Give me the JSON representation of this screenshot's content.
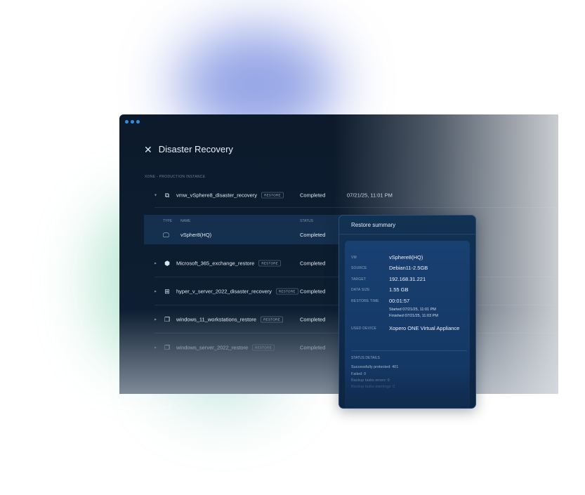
{
  "app": {
    "title": "Disaster Recovery",
    "instance_label": "XONE - PRODUCTION INSTANCE",
    "title_icon": "x-logo-icon"
  },
  "jobs": [
    {
      "name": "vmw_vSphere8_disaster_recovery",
      "badge": "RESTORE",
      "status": "Completed",
      "date": "07/21/25, 11:01 PM",
      "icon": "vm-copy-icon",
      "expanded": true
    },
    {
      "name": "Microsoft_365_exchange_restore",
      "badge": "RESTORE",
      "status": "Completed",
      "date": "",
      "icon": "m365-icon"
    },
    {
      "name": "hyper_v_server_2022_disaster_recovery",
      "badge": "RESTORE",
      "status": "Completed",
      "date": "",
      "icon": "windows-icon"
    },
    {
      "name": "windows_11_workstations_restore",
      "badge": "RESTORE",
      "status": "Completed",
      "date": "",
      "icon": "files-icon"
    },
    {
      "name": "windows_server_2022_restore",
      "badge": "RESTORE",
      "status": "Completed",
      "date": "",
      "icon": "files-icon"
    }
  ],
  "subtable": {
    "headers": {
      "type": "TYPE",
      "name": "NAME",
      "status": "STATUS"
    },
    "row": {
      "name": "vSpher8(HQ)",
      "status": "Completed",
      "icon": "monitor-icon"
    }
  },
  "summary": {
    "title": "Restore summary",
    "fields": {
      "vm": {
        "label": "VM",
        "value": "vSphere8(HQ)"
      },
      "source": {
        "label": "SOURCE",
        "value": "Debian11-2.5GB"
      },
      "target": {
        "label": "TARGET",
        "value": "192.168.31.221"
      },
      "data_size": {
        "label": "DATA SIZE",
        "value": "1.55 GB"
      },
      "restore_time": {
        "label": "RESTORE TIME",
        "value": "00:01:57",
        "started": "Started 07/21/25, 11:01 PM",
        "finished": "Finished 07/21/25, 11:03 PM"
      },
      "used_device": {
        "label": "USED DEVICE",
        "value": "Xopero ONE Virtual Appliance"
      }
    },
    "status_details": {
      "title": "STATUS DETAILS",
      "lines": [
        "Successfully protected: 401",
        "Failed: 0",
        "Backup tasks errors: 0",
        "Backup tasks warnings: 0"
      ]
    }
  },
  "colors": {
    "window_bg": "#0c1a2b",
    "accent_dots": "#2f8fe0",
    "panel_bg": "#123253"
  }
}
